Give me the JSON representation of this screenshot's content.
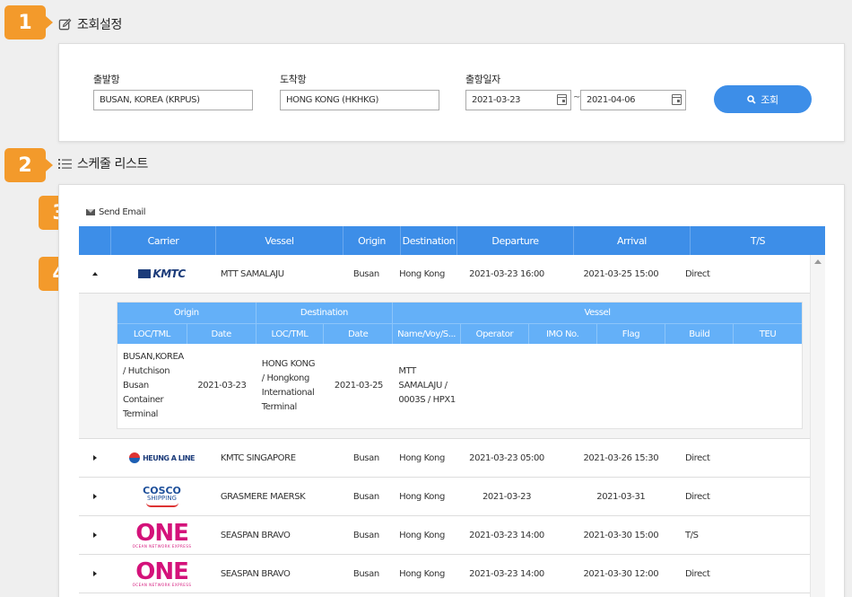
{
  "badges": [
    "1",
    "2",
    "3",
    "4"
  ],
  "sections": {
    "settings_title": "조회설정",
    "list_title": "스케줄 리스트"
  },
  "search": {
    "departure_label": "출발항",
    "departure_value": "BUSAN, KOREA (KRPUS)",
    "arrival_label": "도착항",
    "arrival_value": "HONG KONG (HKHKG)",
    "date_label": "출항일자",
    "date_from": "2021-03-23",
    "date_separator": "~",
    "date_to": "2021-04-06",
    "button_label": "조회"
  },
  "send_email": "Send Email",
  "table": {
    "headers": [
      "",
      "Carrier",
      "Vessel",
      "Origin",
      "Destination",
      "Departure",
      "Arrival",
      "T/S"
    ],
    "rows": [
      {
        "carrier": "KMTC",
        "carrier_icon": "kmtc-logo",
        "vessel": "MTT SAMALAJU",
        "origin": "Busan",
        "destination": "Hong Kong",
        "departure": "2021-03-23 16:00",
        "arrival": "2021-03-25 15:00",
        "ts": "Direct",
        "expanded": true
      },
      {
        "carrier": "HEUNG A LINE",
        "carrier_icon": "heunga-logo",
        "vessel": "KMTC SINGAPORE",
        "origin": "Busan",
        "destination": "Hong Kong",
        "departure": "2021-03-23 05:00",
        "arrival": "2021-03-26 15:30",
        "ts": "Direct"
      },
      {
        "carrier": "COSCO",
        "carrier_sub": "SHIPPING",
        "carrier_icon": "cosco-logo",
        "vessel": "GRASMERE MAERSK",
        "origin": "Busan",
        "destination": "Hong Kong",
        "departure": "2021-03-23",
        "arrival": "2021-03-31",
        "ts": "Direct"
      },
      {
        "carrier": "ONE",
        "carrier_sub": "OCEAN NETWORK EXPRESS",
        "carrier_icon": "one-logo",
        "vessel": "SEASPAN BRAVO",
        "origin": "Busan",
        "destination": "Hong Kong",
        "departure": "2021-03-23 14:00",
        "arrival": "2021-03-30 15:00",
        "ts": "T/S"
      },
      {
        "carrier": "ONE",
        "carrier_sub": "OCEAN NETWORK EXPRESS",
        "carrier_icon": "one-logo",
        "vessel": "SEASPAN BRAVO",
        "origin": "Busan",
        "destination": "Hong Kong",
        "departure": "2021-03-23 14:00",
        "arrival": "2021-03-30 12:00",
        "ts": "Direct"
      }
    ]
  },
  "detail": {
    "group_headers": [
      "Origin",
      "Destination",
      "Vessel"
    ],
    "sub_headers": [
      "LOC/TML",
      "Date",
      "LOC/TML",
      "Date",
      "Name/Voy/S...",
      "Operator",
      "IMO No.",
      "Flag",
      "Build",
      "TEU"
    ],
    "origin_loc": "BUSAN,KOREA / Hutchison Busan Container Terminal",
    "origin_date": "2021-03-23",
    "dest_loc": "HONG KONG / Hongkong International Terminal",
    "dest_date": "2021-03-25",
    "vessel_name": "MTT SAMALAJU / 0003S / HPX1",
    "operator": "",
    "imo": "",
    "flag": "",
    "build": "",
    "teu": ""
  },
  "colors": {
    "accent": "#3d8ee8",
    "detail_header": "#64b0f8",
    "badge": "#f39a2b"
  }
}
